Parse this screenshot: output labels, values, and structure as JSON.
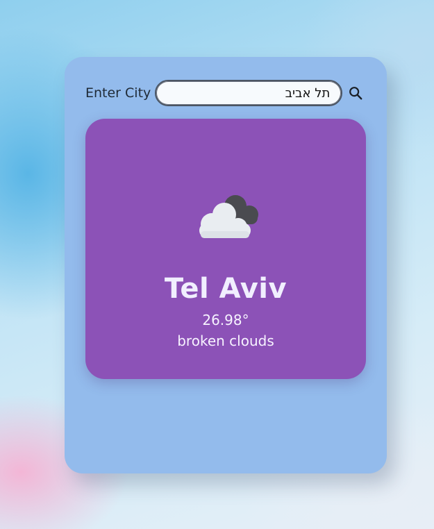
{
  "search": {
    "label": "Enter City",
    "value": "תל אביב",
    "button_icon": "search-icon"
  },
  "weather": {
    "icon": "broken-clouds-icon",
    "city": "Tel Aviv",
    "temperature": "26.98°",
    "description": "broken clouds"
  },
  "colors": {
    "panel": "#93bbec",
    "card": "#8c52b7"
  }
}
